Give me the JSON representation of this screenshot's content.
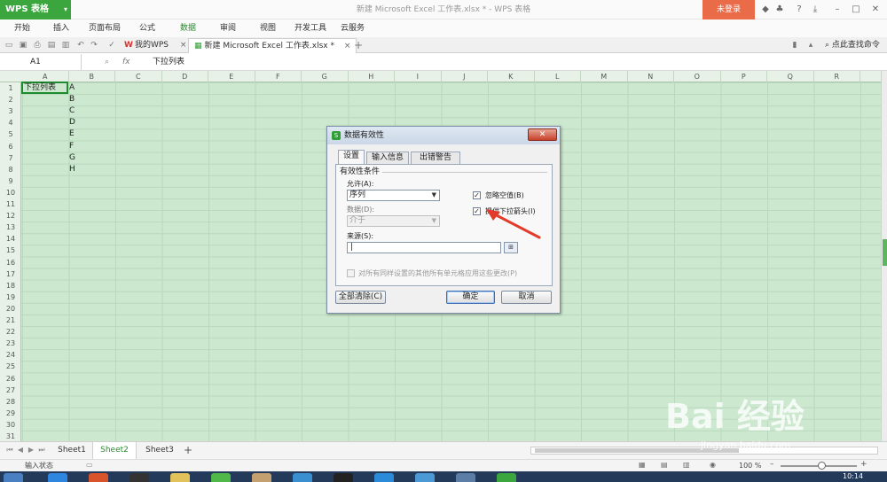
{
  "app": {
    "name": "WPS 表格",
    "doc_title": "新建 Microsoft Excel 工作表.xlsx * - WPS 表格",
    "login": "未登录"
  },
  "menu": [
    "开始",
    "插入",
    "页面布局",
    "公式",
    "数据",
    "审阅",
    "视图",
    "开发工具",
    "云服务"
  ],
  "menu_active": "数据",
  "tabs": {
    "my_wps": "我的WPS",
    "doc": "新建 Microsoft Excel 工作表.xlsx *",
    "search_cmd": "点此查找命令"
  },
  "formula_bar": {
    "cell_ref": "A1",
    "fx": "fx",
    "content": "下拉列表"
  },
  "grid": {
    "columns": [
      "A",
      "B",
      "C",
      "D",
      "E",
      "F",
      "G",
      "H",
      "I",
      "J",
      "K",
      "L",
      "M",
      "N",
      "O",
      "P",
      "Q",
      "R"
    ],
    "rows": [
      "1",
      "2",
      "3",
      "4",
      "5",
      "6",
      "7",
      "8",
      "9",
      "10",
      "11",
      "12",
      "13",
      "14",
      "15",
      "16",
      "17",
      "18",
      "19",
      "20",
      "21",
      "22",
      "23",
      "24",
      "25",
      "26",
      "27",
      "28",
      "29",
      "30",
      "31"
    ],
    "a1": "下拉列表",
    "b_values": [
      "A",
      "B",
      "C",
      "D",
      "E",
      "F",
      "G",
      "H"
    ]
  },
  "sheets": [
    "Sheet1",
    "Sheet2",
    "Sheet3"
  ],
  "active_sheet": "Sheet2",
  "status": {
    "text": "输入状态",
    "zoom": "100 %"
  },
  "clock": "10:14",
  "dialog": {
    "title": "数据有效性",
    "tabs": [
      "设置",
      "输入信息",
      "出错警告"
    ],
    "group_title": "有效性条件",
    "allow_label": "允许(A):",
    "allow_value": "序列",
    "data_label": "数据(D):",
    "data_value": "介于",
    "source_label": "来源(S):",
    "source_value": "|",
    "ignore_blank": "忽略空值(B)",
    "dropdown_arrow": "提供下拉箭头(I)",
    "apply_all": "对所有同样设置的其他所有单元格应用这些更改(P)",
    "clear_all": "全部清除(C)",
    "ok": "确定",
    "cancel": "取消",
    "ignore_blank_checked": true,
    "dropdown_checked": true
  },
  "watermark": {
    "main": "Bai 经验",
    "sub": "jingyan.baidu.com"
  },
  "colors": {
    "accent": "#3aa63d",
    "grid_bg": "#cce8cf",
    "login_bg": "#e96b48"
  }
}
